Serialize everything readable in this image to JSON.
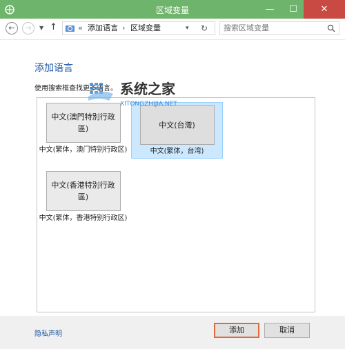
{
  "window": {
    "title": "区域变量",
    "app_icon": "region-gear-icon",
    "controls": {
      "minimize": "—",
      "maximize": "☐",
      "close": "✕"
    }
  },
  "address_bar": {
    "back": "←",
    "forward": "→",
    "recent_arrow": "▼",
    "up": "↑",
    "breadcrumb": {
      "sep0": "«",
      "item1": "添加语言",
      "sep1": "›",
      "item2": "区域变量",
      "dropdown": "▾",
      "refresh": "↻"
    },
    "search_placeholder": "搜索区域变量"
  },
  "main": {
    "heading": "添加语言",
    "instruction": "使用搜索框查找更多语言。",
    "watermark": {
      "logo": "系统之家",
      "url": "XITONGZHIJIA.NET"
    },
    "languages": [
      {
        "tile": "中文(澳門特別行政區)",
        "caption": "中文(繁体，澳门特别行政区)",
        "selected": false
      },
      {
        "tile": "中文(台灣)",
        "caption": "中文(繁体，台湾)",
        "selected": true
      },
      {
        "tile": "中文(香港特別行政區)",
        "caption": "中文(繁体，香港特别行政区)",
        "selected": false
      }
    ]
  },
  "footer": {
    "privacy_link": "隐私声明",
    "add_button": "添加",
    "cancel_button": "取消"
  },
  "colors": {
    "titlebar": "#6fb46c",
    "close_button": "#c94a43",
    "link": "#1a56a3",
    "selection": "#cce8ff",
    "highlight_border": "#e06a3b"
  }
}
